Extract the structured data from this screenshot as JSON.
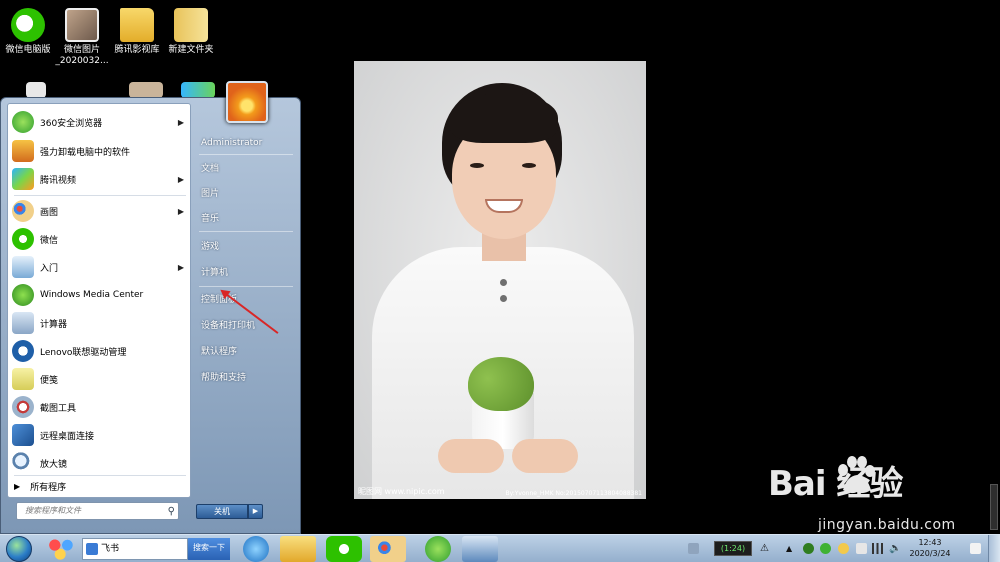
{
  "desktop": {
    "icons": [
      {
        "label": "微信电脑版",
        "icon": "wechat-icon"
      },
      {
        "label": "微信图片\n_2020032...",
        "icon": "photo-icon"
      },
      {
        "label": "腾讯影视库",
        "icon": "folder-icon"
      },
      {
        "label": "新建文件夹",
        "icon": "folder-icon"
      }
    ]
  },
  "start_menu": {
    "programs": [
      {
        "label": "360安全浏览器",
        "has_submenu": true
      },
      {
        "label": "强力卸载电脑中的软件",
        "has_submenu": false
      },
      {
        "label": "腾讯视频",
        "has_submenu": true
      },
      {
        "label": "画图",
        "has_submenu": true
      },
      {
        "label": "微信",
        "has_submenu": false
      },
      {
        "label": "入门",
        "has_submenu": true
      },
      {
        "label": "Windows Media Center",
        "has_submenu": false
      },
      {
        "label": "计算器",
        "has_submenu": false
      },
      {
        "label": "Lenovo联想驱动管理",
        "has_submenu": false
      },
      {
        "label": "便笺",
        "has_submenu": false
      },
      {
        "label": "截图工具",
        "has_submenu": false
      },
      {
        "label": "远程桌面连接",
        "has_submenu": false
      },
      {
        "label": "放大镜",
        "has_submenu": false
      }
    ],
    "all_programs": "所有程序",
    "search_placeholder": "搜索程序和文件",
    "right_items": [
      "Administrator",
      "文档",
      "图片",
      "音乐",
      "游戏",
      "计算机",
      "控制面板",
      "设备和打印机",
      "默认程序",
      "帮助和支持"
    ],
    "shutdown_label": "关机"
  },
  "photo": {
    "watermark_left": "昵图网 www.nipic.com",
    "watermark_right": "By:Yvonne_HMK No:20150707113804088381"
  },
  "watermark": {
    "logo_text": "Bai  经验",
    "url": "jingyan.baidu.com"
  },
  "taskbar": {
    "feishu_label": "飞书",
    "feishu_search": "搜索一下",
    "battery": "(1:24)",
    "time": "12:43",
    "date": "2020/3/24"
  },
  "colors": {
    "taskbar": "#94afcd",
    "start_menu": "#7d97b5",
    "arrow": "#d92626"
  }
}
